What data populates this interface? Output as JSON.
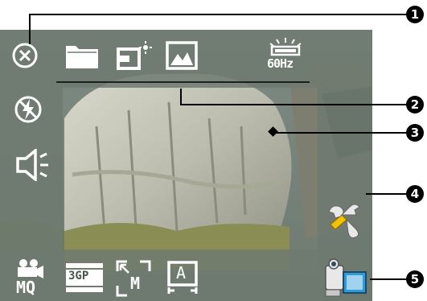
{
  "top_bar": {
    "close": {
      "icon": "close-circle-icon"
    },
    "folder": {
      "icon": "folder-icon"
    },
    "lighting": {
      "icon": "lighting-mode-icon"
    },
    "image": {
      "icon": "image-icon"
    },
    "flicker": {
      "icon": "flicker-icon",
      "label": "60Hz"
    }
  },
  "left_bar": {
    "flash": {
      "icon": "flash-off-icon"
    },
    "sound": {
      "icon": "speaker-icon"
    }
  },
  "bottom_bar": {
    "video_quality": {
      "icon": "video-quality-icon",
      "label": "MQ"
    },
    "format": {
      "icon": "video-format-icon",
      "label": "3GP"
    },
    "zoom": {
      "icon": "zoom-icon",
      "label": "M"
    },
    "auto": {
      "icon": "auto-mode-icon",
      "label": "A"
    }
  },
  "right_bar": {
    "settings": {
      "icon": "wrench-icon"
    },
    "mode": {
      "icon": "camcorder-icon"
    }
  },
  "callouts": [
    "1",
    "2",
    "3",
    "4",
    "5"
  ],
  "colors": {
    "overlay": "#6e7a70",
    "icon": "#ffffff",
    "callout": "#000000"
  }
}
